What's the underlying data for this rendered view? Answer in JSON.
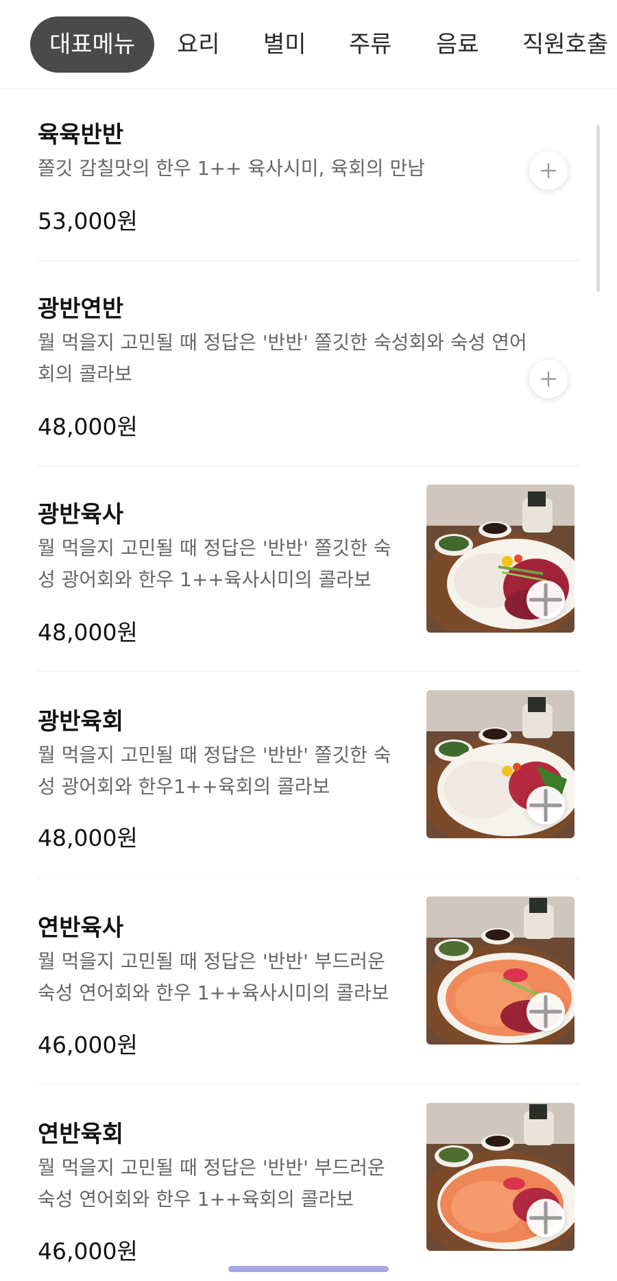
{
  "tabs": [
    "대표메뉴",
    "요리",
    "별미",
    "주류",
    "음료",
    "직원호출"
  ],
  "menu": [
    {
      "name": "육육반반",
      "desc": " 쫄깃 감칠맛의 한우 1++ 육사시미, 육회의 만남",
      "price": "53,000원"
    },
    {
      "name": "광반연반",
      "desc": "뭘 먹을지 고민될 때 정답은 '반반' 쫄깃한 숙성회와 숙성 연어회의 콜라보",
      "price": "48,000원"
    },
    {
      "name": "광반육사",
      "desc": "뭘 먹을지 고민될 때 정답은 '반반' 쫄깃한 숙성 광어회와 한우 1++육사시미의 콜라보",
      "price": "48,000원",
      "image": "raw-beef-flatfish-platter-photo"
    },
    {
      "name": "광반육회",
      "desc": "뭘 먹을지 고민될 때 정답은 '반반' 쫄깃한 숙성 광어회와 한우1++육회의 콜라보",
      "price": "48,000원",
      "image": "beef-tartare-flatfish-platter-photo"
    },
    {
      "name": "연반육사",
      "desc": "뭘 먹을지 고민될 때 정답은 '반반' 부드러운 숙성 연어회와 한우 1++육사시미의 콜라보",
      "price": "46,000원",
      "image": "salmon-raw-beef-platter-photo"
    },
    {
      "name": "연반육회",
      "desc": "뭘 먹을지 고민될 때 정답은 '반반' 부드러운 숙성 연어회와 한우 1++육회의 콜라보",
      "price": "46,000원",
      "image": "salmon-beef-tartare-platter-photo"
    }
  ],
  "colors": {
    "active_tab_bg": "#4a4a4a",
    "home_indicator": "#a9a6e6",
    "desc_text": "#666666"
  },
  "icons": {
    "add": "plus-icon"
  }
}
